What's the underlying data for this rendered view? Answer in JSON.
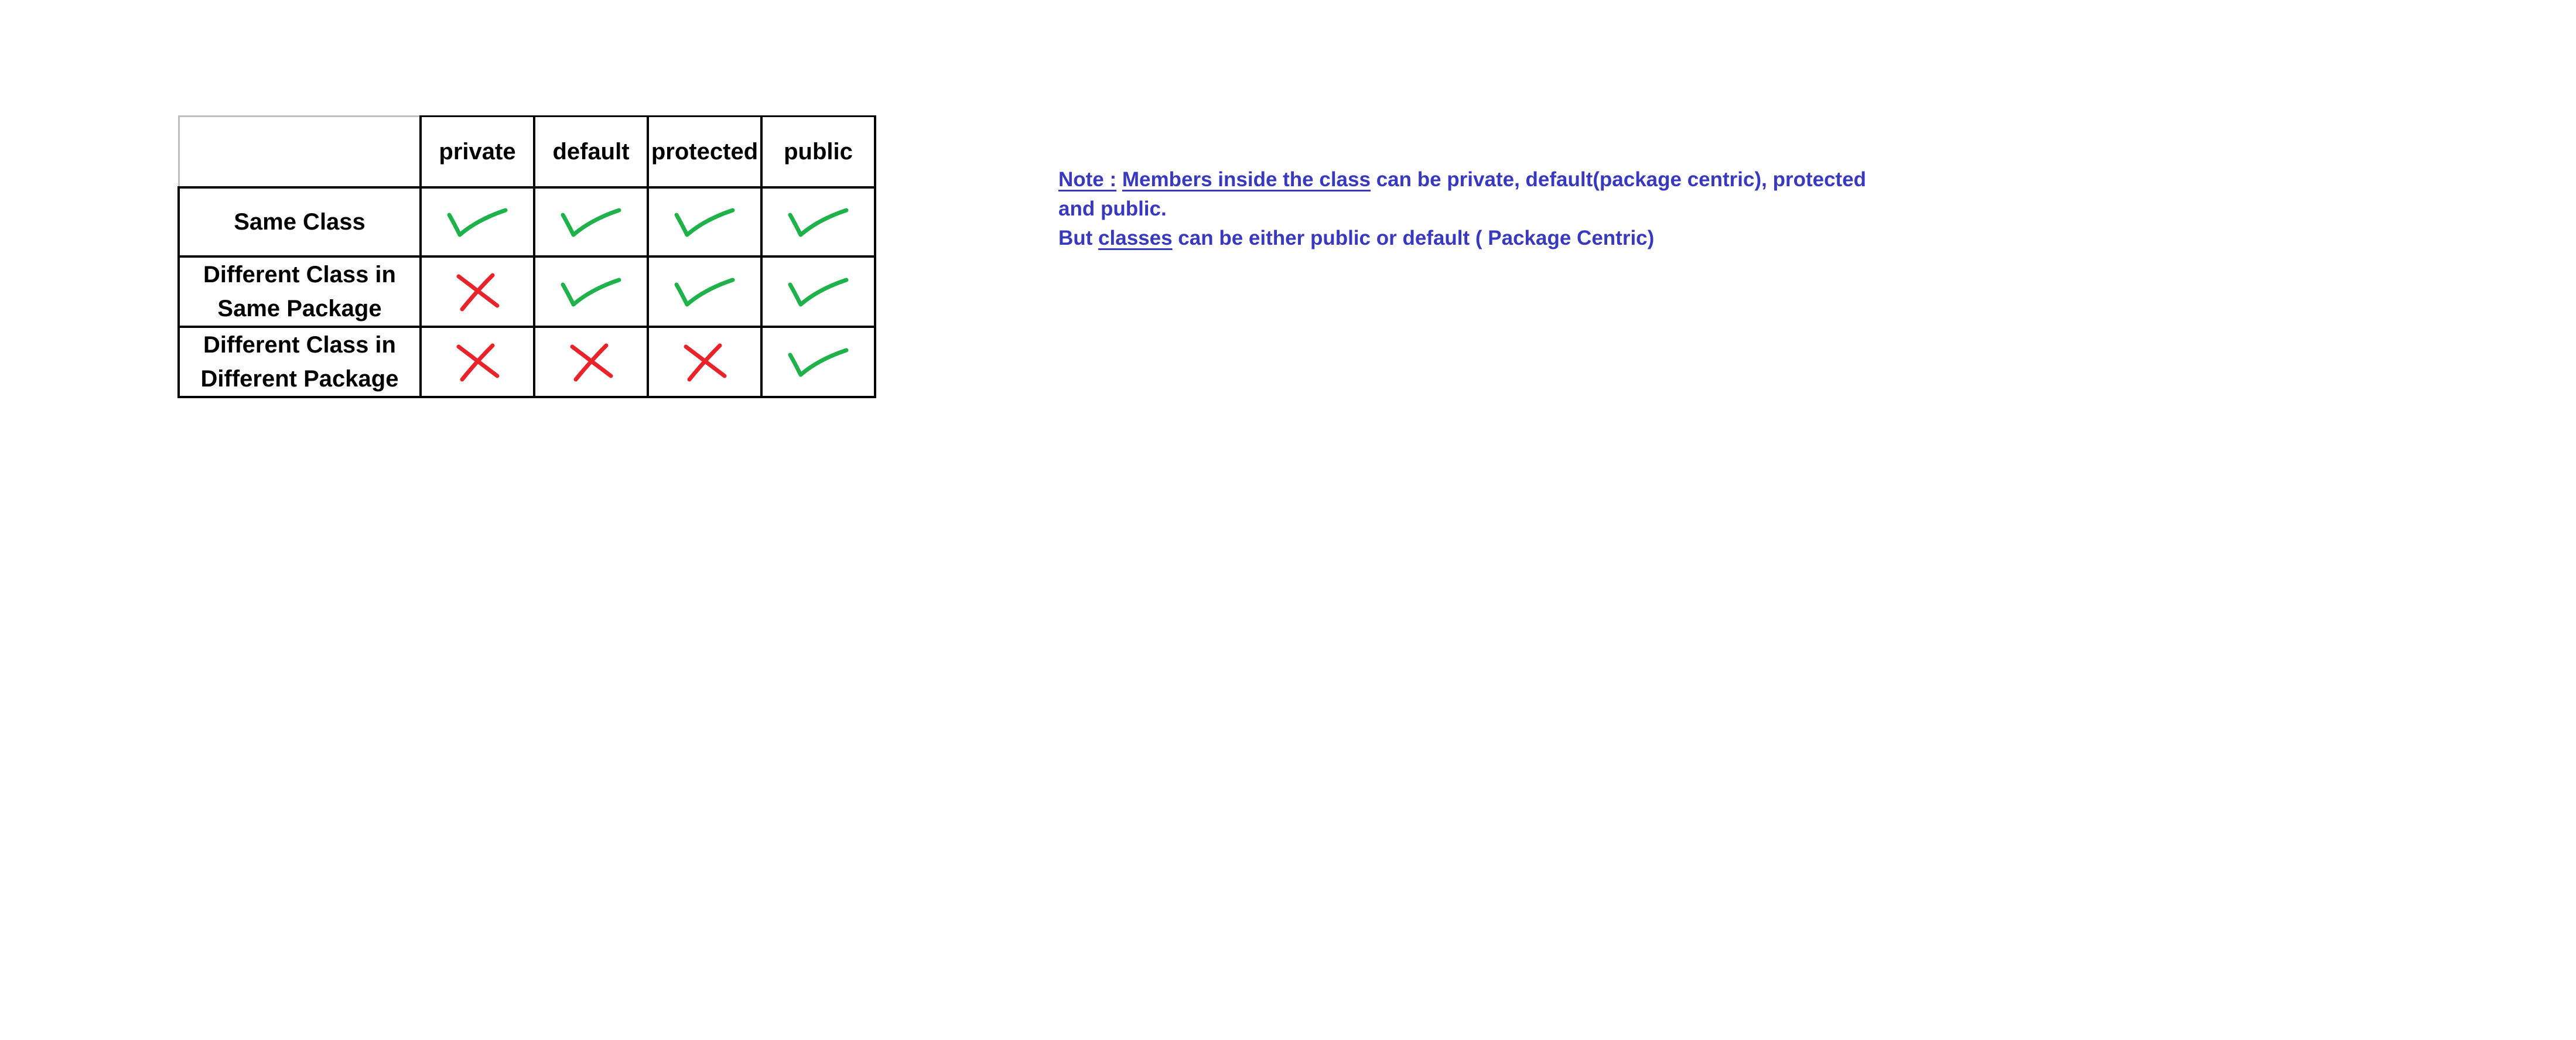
{
  "table": {
    "columns": [
      "private",
      "default",
      "protected",
      "public"
    ],
    "rows": [
      {
        "label_lines": [
          "Same Class"
        ],
        "access": [
          "yes",
          "yes",
          "yes",
          "yes"
        ]
      },
      {
        "label_lines": [
          "Different Class in",
          "Same Package"
        ],
        "access": [
          "no",
          "yes",
          "yes",
          "yes"
        ]
      },
      {
        "label_lines": [
          "Different Class in",
          "Different Package"
        ],
        "access": [
          "no",
          "no",
          "no",
          "yes"
        ]
      }
    ],
    "colors": {
      "check": "#1fb24a",
      "cross": "#e8232a"
    }
  },
  "note": {
    "note_label": "Note :",
    "members_phrase": "Members inside the class",
    "members_rest_line1": " can be private, default(package centric), protected",
    "members_rest_line2": "and public.",
    "but_prefix": "But ",
    "classes_word": "classes",
    "classes_rest": " can be either public or default ( Package Centric)",
    "color": "#3939c0"
  }
}
